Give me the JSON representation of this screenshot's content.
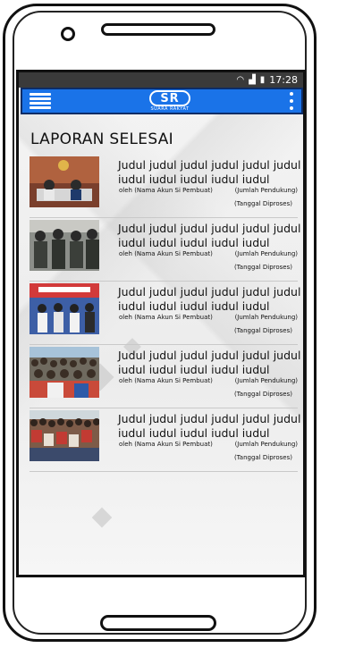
{
  "status_bar": {
    "time": "17:28"
  },
  "app_bar": {
    "logo_mark": "SR",
    "logo_sub": "SUARA RAKYAT"
  },
  "page": {
    "title": "LAPORAN SELESAI"
  },
  "reports": [
    {
      "title": "Judul judul judul judul judul judul iudul iudul iudul iudul iudul",
      "author": "oleh (Nama Akun Si Pembuat)",
      "support": "(Jumlah Pendukung)",
      "date": "(Tanggal Diproses)"
    },
    {
      "title": "Judul judul judul judul judul judul iudul iudul iudul iudul iudul",
      "author": "oleh (Nama Akun Si Pembuat)",
      "support": "(Jumlah Pendukung)",
      "date": "(Tanggal Diproses)"
    },
    {
      "title": "Judul judul judul judul judul judul iudul iudul iudul iudul iudul",
      "author": "oleh (Nama Akun Si Pembuat)",
      "support": "(Jumlah Pendukung)",
      "date": "(Tanggal Diproses)"
    },
    {
      "title": "Judul judul judul judul judul judul iudul iudul iudul iudul iudul",
      "author": "oleh (Nama Akun Si Pembuat)",
      "support": "(Jumlah Pendukung)",
      "date": "(Tanggal Diproses)"
    },
    {
      "title": "Judul judul judul judul judul judul iudul iudul iudul iudul iudul",
      "author": "oleh (Nama Akun Si Pembuat)",
      "support": "(Jumlah Pendukung)",
      "date": "(Tanggal Diproses)"
    }
  ],
  "icons": {
    "menu": "hamburger-icon",
    "more": "kebab-menu-icon",
    "wifi": "wifi-icon",
    "signal": "signal-icon",
    "battery": "battery-icon"
  },
  "colors": {
    "app_bar": "#1a73e8",
    "status_bar": "#3a3a3a"
  }
}
